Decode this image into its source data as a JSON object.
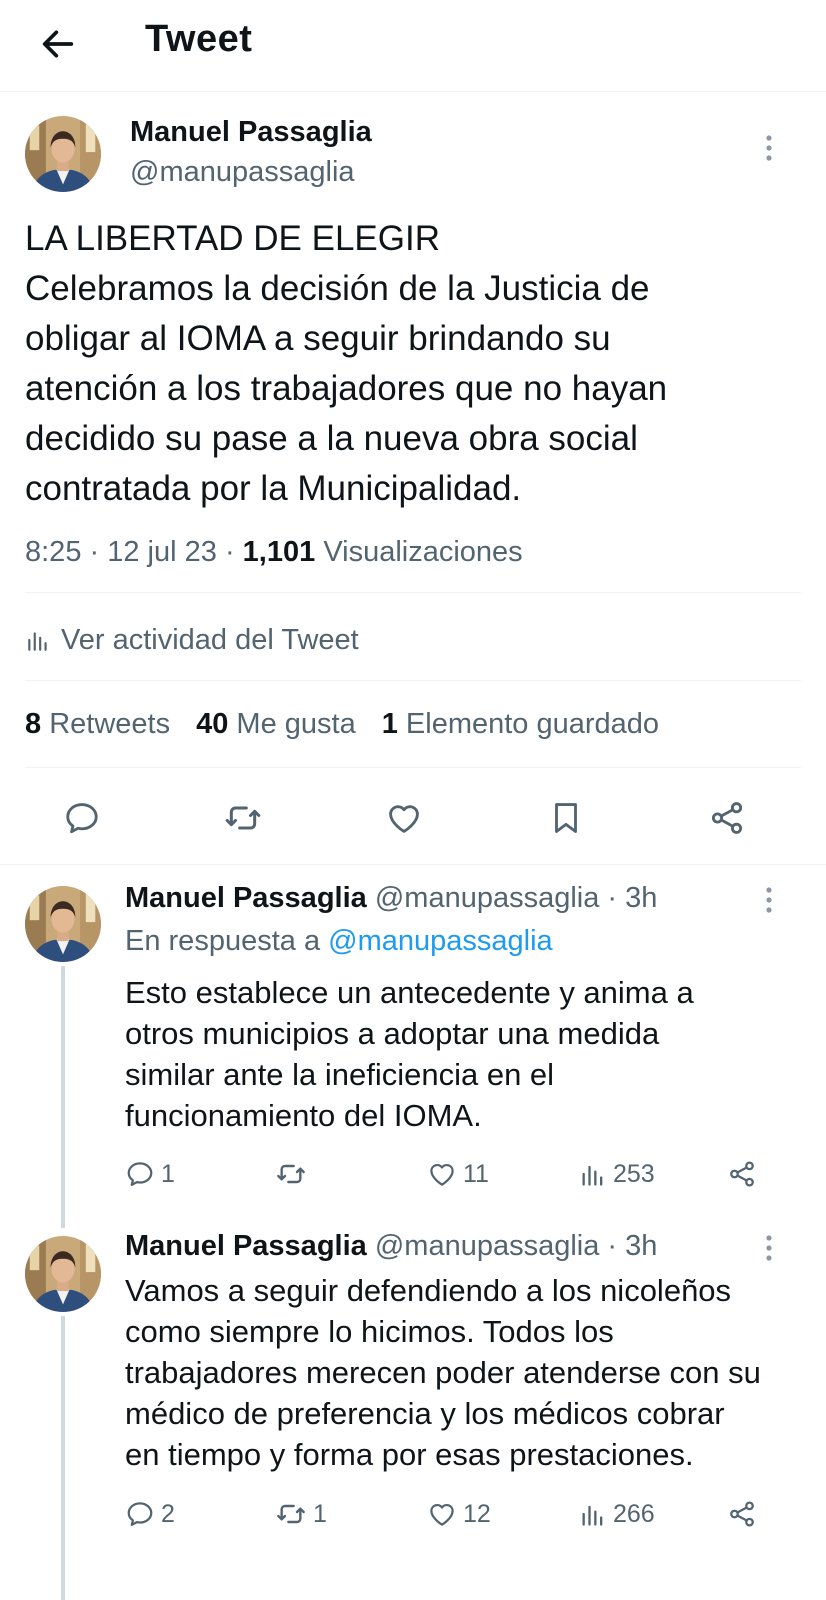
{
  "header": {
    "title": "Tweet"
  },
  "main_tweet": {
    "author_name": "Manuel Passaglia",
    "author_handle": "@manupassaglia",
    "text_lines": [
      "LA LIBERTAD DE ELEGIR",
      "Celebramos la decisión de la Justicia de",
      "obligar al IOMA a seguir brindando su",
      "atención a los trabajadores que no hayan",
      "decidido su pase a la nueva obra social",
      "contratada por la Municipalidad."
    ],
    "time": "8:25",
    "date": "12 jul 23",
    "views_count": "1,101",
    "views_label": "Visualizaciones",
    "activity_label": "Ver actividad del Tweet",
    "retweets_count": "8",
    "retweets_label": "Retweets",
    "likes_count": "40",
    "likes_label": "Me gusta",
    "bookmarks_count": "1",
    "bookmarks_label": "Elemento guardado"
  },
  "replies": [
    {
      "author_name": "Manuel Passaglia",
      "author_handle": "@manupassaglia",
      "time_ago": "3h",
      "reply_to_prefix": "En respuesta a",
      "reply_to_handle": "@manupassaglia",
      "text_lines": [
        "Esto establece un antecedente y anima a",
        "otros municipios a adoptar una medida",
        "similar ante la ineficiencia en el",
        "funcionamiento del IOMA."
      ],
      "replies_count": "1",
      "retweets_count": "",
      "likes_count": "11",
      "views_count": "253"
    },
    {
      "author_name": "Manuel Passaglia",
      "author_handle": "@manupassaglia",
      "time_ago": "3h",
      "text_lines": [
        "Vamos a seguir defendiendo a los nicoleños",
        "como siempre lo hicimos. Todos los",
        "trabajadores merecen poder atenderse con su",
        "médico de preferencia y los médicos cobrar",
        "en tiempo y forma por esas prestaciones."
      ],
      "replies_count": "2",
      "retweets_count": "1",
      "likes_count": "12",
      "views_count": "266"
    }
  ],
  "colors": {
    "text_primary": "#0f1419",
    "text_secondary": "#536471",
    "link": "#1d9bf0",
    "divider": "#eff3f4",
    "thread_line": "#cfd9de"
  },
  "icons": {
    "back": "arrow-left-icon",
    "more": "more-vertical-icon",
    "reply": "reply-icon",
    "retweet": "retweet-icon",
    "like": "heart-icon",
    "bookmark": "bookmark-icon",
    "share": "share-icon",
    "views": "bar-chart-icon"
  }
}
